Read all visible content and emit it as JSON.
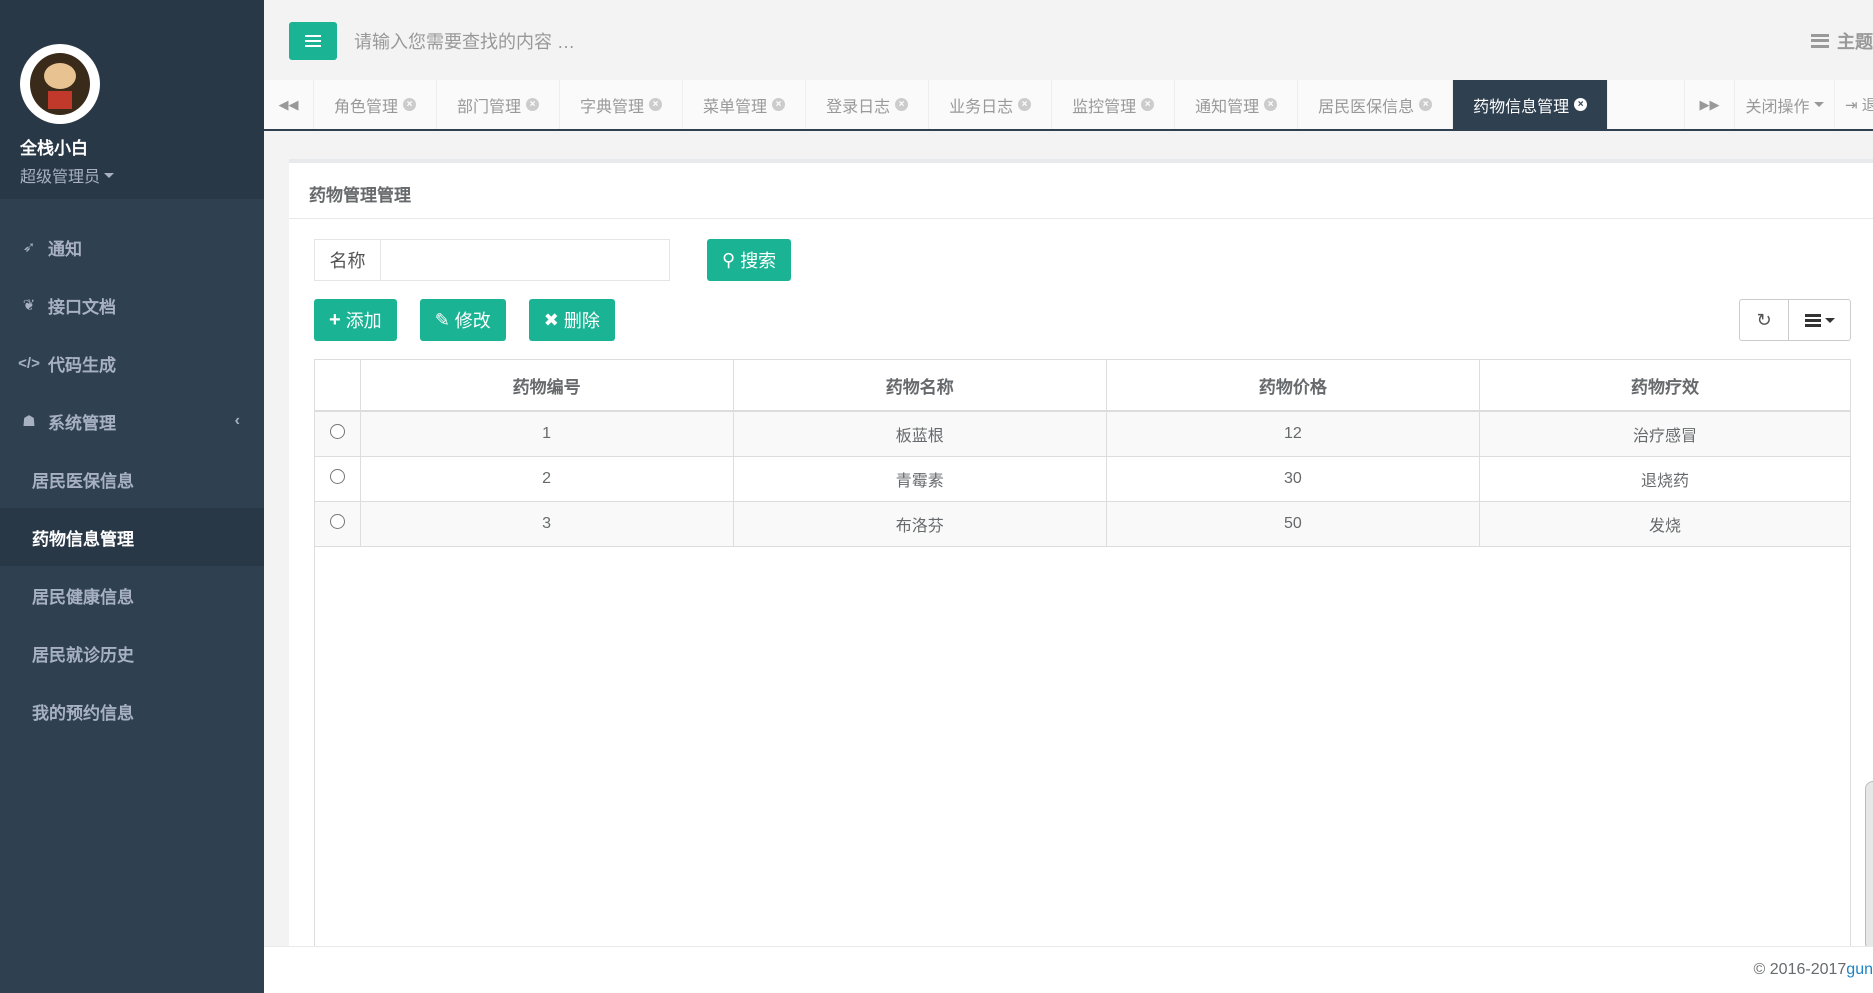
{
  "user": {
    "name": "全栈小白",
    "role": "超级管理员"
  },
  "nav": {
    "items": [
      {
        "label": "通知",
        "icon": "rocket-icon"
      },
      {
        "label": "接口文档",
        "icon": "leaf-icon"
      },
      {
        "label": "代码生成",
        "icon": "code-icon"
      },
      {
        "label": "系统管理",
        "icon": "user-icon"
      }
    ],
    "sub_items": [
      {
        "label": "居民医保信息"
      },
      {
        "label": "药物信息管理",
        "active": true
      },
      {
        "label": "居民健康信息"
      },
      {
        "label": "居民就诊历史"
      },
      {
        "label": "我的预约信息"
      }
    ]
  },
  "header": {
    "search_placeholder": "请输入您需要查找的内容 …",
    "theme_label": "主题"
  },
  "tabs": {
    "items": [
      {
        "label": "角色管理"
      },
      {
        "label": "部门管理"
      },
      {
        "label": "字典管理"
      },
      {
        "label": "菜单管理"
      },
      {
        "label": "登录日志"
      },
      {
        "label": "业务日志"
      },
      {
        "label": "监控管理"
      },
      {
        "label": "通知管理"
      },
      {
        "label": "居民医保信息"
      },
      {
        "label": "药物信息管理",
        "active": true
      }
    ],
    "close_ops_label": "关闭操作",
    "logout_label": "退"
  },
  "panel": {
    "title": "药物管理管理",
    "filter_label": "名称",
    "filter_value": "",
    "search_label": "搜索",
    "add_label": "添加",
    "edit_label": "修改",
    "delete_label": "删除"
  },
  "table": {
    "columns": [
      "药物编号",
      "药物名称",
      "药物价格",
      "药物疗效"
    ],
    "rows": [
      [
        "1",
        "板蓝根",
        "12",
        "治疗感冒"
      ],
      [
        "2",
        "青霉素",
        "30",
        "退烧药"
      ],
      [
        "3",
        "布洛芬",
        "50",
        "发烧"
      ]
    ]
  },
  "footer": {
    "copyright": "© 2016-2017 ",
    "link": "gun"
  },
  "colors": {
    "sidebar": "#2f4050",
    "accent": "#1ab394",
    "tab_active": "#2f4050"
  }
}
